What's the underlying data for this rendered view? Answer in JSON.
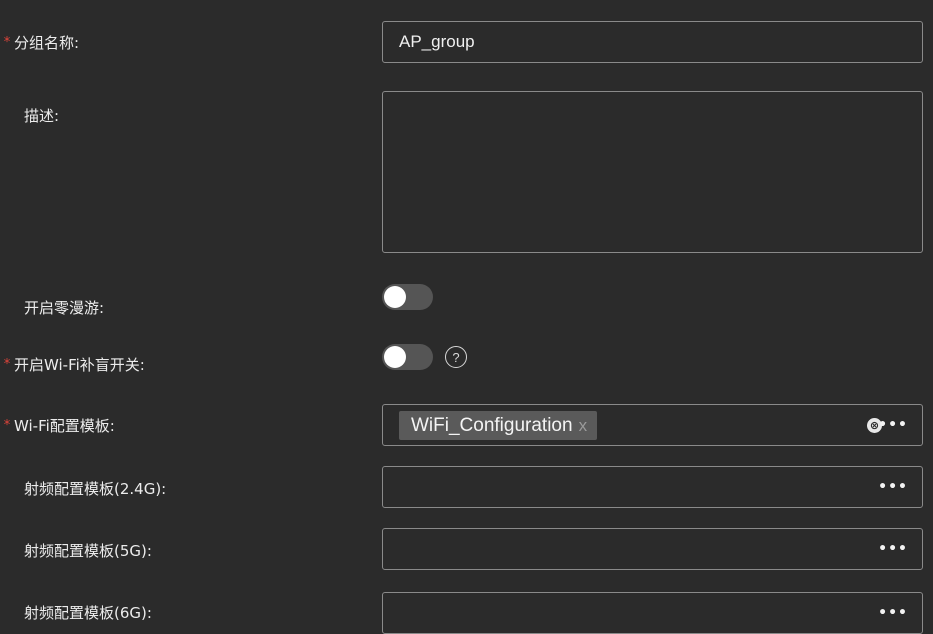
{
  "form": {
    "group_name": {
      "label": "分组名称:",
      "required_mark": "*",
      "value": "AP_group"
    },
    "description": {
      "label": "描述:",
      "value": ""
    },
    "zero_roaming": {
      "label": "开启零漫游:",
      "enabled": false
    },
    "wifi_blind_fill": {
      "label": "开启Wi-Fi补盲开关:",
      "required_mark": "*",
      "enabled": false,
      "help_icon": "?"
    },
    "wifi_template": {
      "label": "Wi-Fi配置模板:",
      "required_mark": "*",
      "chip_label": "WiFi_Configuration",
      "chip_remove": "x",
      "clear_icon": "⊗",
      "more_icon": "•••"
    },
    "rf_24g": {
      "label": "射频配置模板(2.4G):",
      "more_icon": "•••"
    },
    "rf_5g": {
      "label": "射频配置模板(5G):",
      "more_icon": "•••"
    },
    "rf_6g": {
      "label": "射频配置模板(6G):",
      "more_icon": "•••"
    }
  },
  "colors": {
    "background": "#2b2b2b",
    "border": "#8a8a8a",
    "required": "#e0453b",
    "toggle_off": "#555555",
    "chip_bg": "#5a5a5a"
  }
}
